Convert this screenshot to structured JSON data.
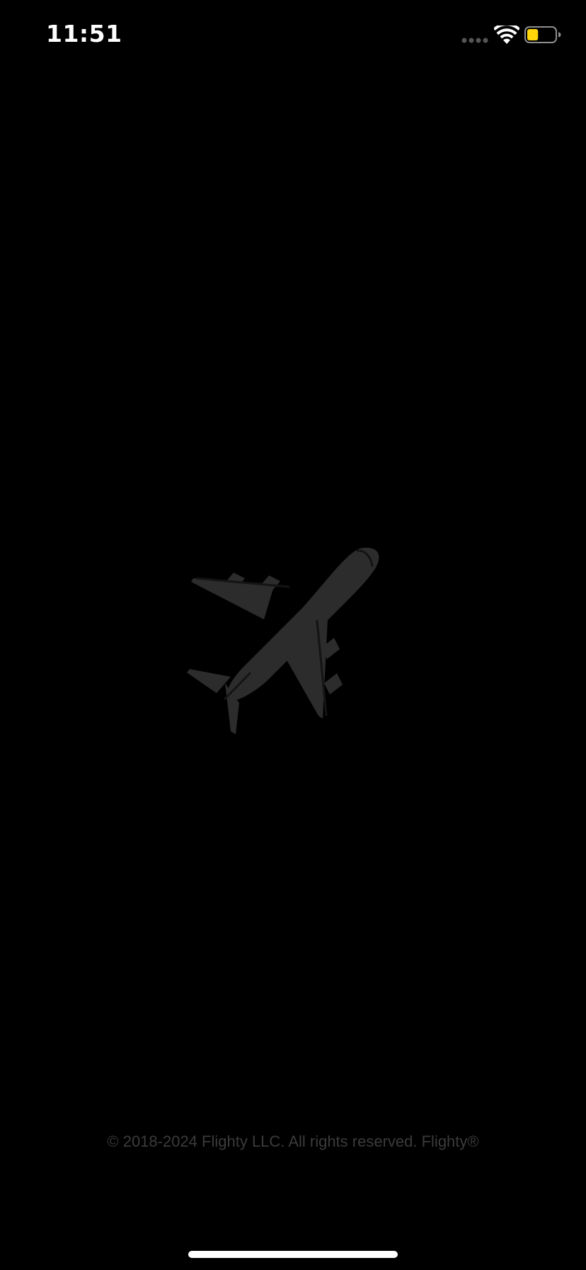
{
  "status_bar": {
    "time": "11:51",
    "signal_icon": "cellular-signal-icon",
    "wifi_icon": "wifi-icon",
    "battery_icon": "battery-icon",
    "battery_level": 0.4,
    "battery_color": "#ffd60a"
  },
  "splash": {
    "logo_icon": "airplane-icon",
    "logo_color": "#2c2c2c",
    "copyright": "© 2018-2024 Flighty LLC. All rights reserved. Flighty®"
  },
  "colors": {
    "background": "#000000",
    "text_muted": "#3b3b3b",
    "home_indicator": "#ffffff"
  }
}
